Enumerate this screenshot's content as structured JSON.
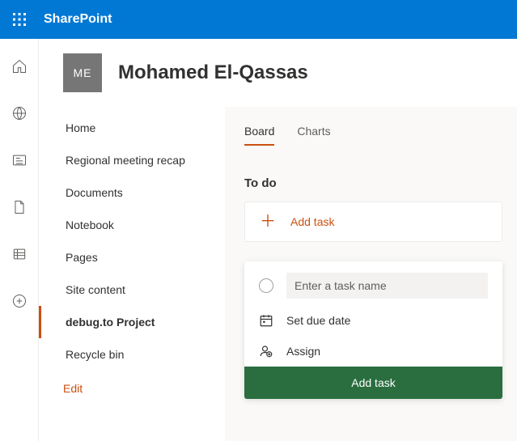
{
  "suite": {
    "app_name": "SharePoint"
  },
  "site": {
    "logo_initials": "ME",
    "title": "Mohamed El-Qassas"
  },
  "nav": {
    "items": [
      {
        "label": "Home"
      },
      {
        "label": "Regional meeting recap"
      },
      {
        "label": "Documents"
      },
      {
        "label": "Notebook"
      },
      {
        "label": "Pages"
      },
      {
        "label": "Site content"
      },
      {
        "label": "debug.to Project"
      },
      {
        "label": "Recycle bin"
      }
    ],
    "edit_label": "Edit"
  },
  "tabs": {
    "board": "Board",
    "charts": "Charts"
  },
  "planner": {
    "bucket_title": "To do",
    "add_task_link": "Add task",
    "task_name_placeholder": "Enter a task name",
    "due_date": "Set due date",
    "assign": "Assign",
    "submit": "Add task"
  }
}
